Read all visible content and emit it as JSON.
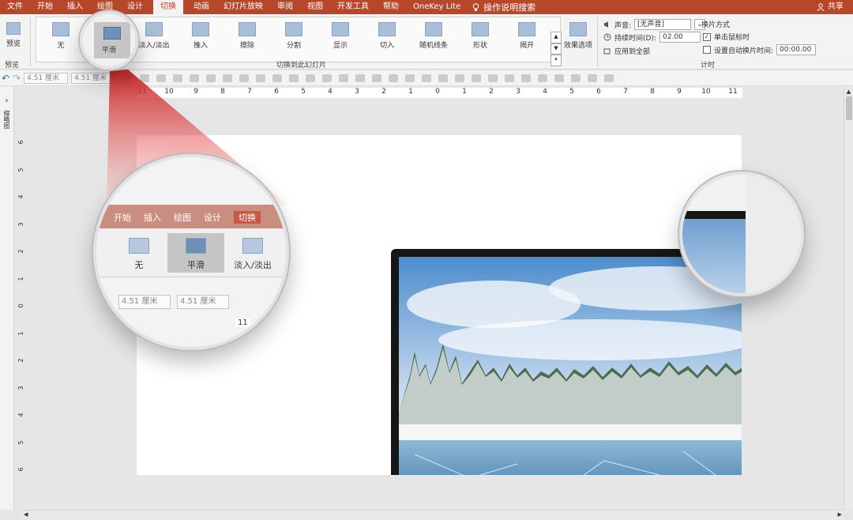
{
  "menubar": {
    "items": [
      {
        "label": "文件",
        "active": false
      },
      {
        "label": "开始",
        "active": false
      },
      {
        "label": "插入",
        "active": false
      },
      {
        "label": "绘图",
        "active": false
      },
      {
        "label": "设计",
        "active": false
      },
      {
        "label": "切换",
        "active": true
      },
      {
        "label": "动画",
        "active": false
      },
      {
        "label": "幻灯片放映",
        "active": false
      },
      {
        "label": "审阅",
        "active": false
      },
      {
        "label": "视图",
        "active": false
      },
      {
        "label": "开发工具",
        "active": false
      },
      {
        "label": "帮助",
        "active": false
      },
      {
        "label": "OneKey Lite",
        "active": false
      }
    ],
    "search_label": "操作说明搜索",
    "share_label": "共享",
    "accent": "#b7472a"
  },
  "ribbon": {
    "preview": {
      "button_label": "预览",
      "group_label": "预览"
    },
    "transitions": [
      {
        "label": "无",
        "selected": false
      },
      {
        "label": "平滑",
        "selected": true
      },
      {
        "label": "淡入/淡出",
        "selected": false
      },
      {
        "label": "推入",
        "selected": false
      },
      {
        "label": "擦除",
        "selected": false
      },
      {
        "label": "分割",
        "selected": false
      },
      {
        "label": "显示",
        "selected": false
      },
      {
        "label": "切入",
        "selected": false
      },
      {
        "label": "随机线条",
        "selected": false
      },
      {
        "label": "形状",
        "selected": false
      },
      {
        "label": "揭开",
        "selected": false
      }
    ],
    "effect_options_label": "效果选项",
    "transitions_group_label": "切换到此幻灯片",
    "timing": {
      "sound_label": "声音:",
      "sound_value": "[无声音]",
      "duration_label": "持续时间(D):",
      "duration_value": "02.00",
      "apply_all_label": "应用到全部",
      "advance_title": "换片方式",
      "on_click_label": "单击鼠标时",
      "on_click_checked": true,
      "after_label": "设置自动换片时间:",
      "after_checked": false,
      "after_value": "00:00.00",
      "group_label": "计时"
    }
  },
  "toolbar": {
    "height_value": "4.51 厘米",
    "width_value": "4.51 厘米"
  },
  "leftpane": {
    "label": "缩略图"
  },
  "ruler": {
    "h_ticks": [
      "11",
      "10",
      "9",
      "8",
      "7",
      "6",
      "5",
      "4",
      "3",
      "2",
      "1",
      "0",
      "1",
      "2",
      "3",
      "4",
      "5",
      "6",
      "7",
      "8",
      "9",
      "10",
      "11"
    ],
    "v_ticks": [
      "6",
      "5",
      "4",
      "3",
      "2",
      "1",
      "0",
      "1",
      "2",
      "3",
      "4",
      "5",
      "6"
    ]
  },
  "magnifier": {
    "tabs": [
      "开始",
      "插入",
      "绘图",
      "设计",
      "切换"
    ],
    "items": [
      {
        "label": "无",
        "selected": false
      },
      {
        "label": "平滑",
        "selected": true
      },
      {
        "label": "淡入/淡出",
        "selected": false
      }
    ],
    "field1": "4.51 厘米",
    "field2": "4.51 厘米",
    "ruler_num": "11"
  }
}
